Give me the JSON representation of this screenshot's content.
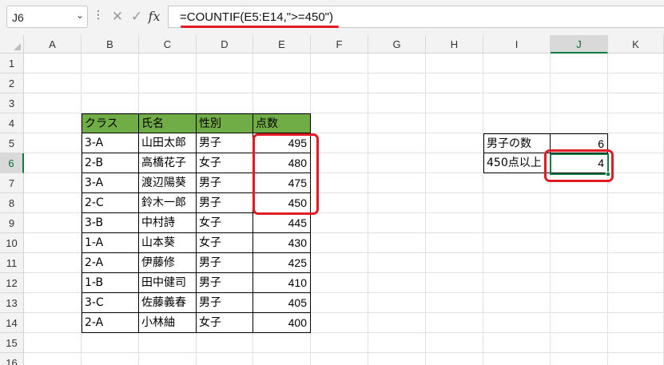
{
  "formula_bar": {
    "name_box": "J6",
    "cancel_icon": "✕",
    "enter_icon": "✓",
    "fx_label": "fx",
    "formula": "=COUNTIF(E5:E14,\">=450\")"
  },
  "columns": [
    "A",
    "B",
    "C",
    "D",
    "E",
    "F",
    "G",
    "H",
    "I",
    "J",
    "K"
  ],
  "rows": [
    "1",
    "2",
    "3",
    "4",
    "5",
    "6",
    "7",
    "8",
    "9",
    "10",
    "11",
    "12",
    "13",
    "14",
    "15",
    "16"
  ],
  "table": {
    "headers": [
      "クラス",
      "氏名",
      "性別",
      "点数"
    ],
    "rows": [
      [
        "3-A",
        "山田太郎",
        "男子",
        "495"
      ],
      [
        "2-B",
        "高橋花子",
        "女子",
        "480"
      ],
      [
        "3-A",
        "渡辺陽葵",
        "男子",
        "475"
      ],
      [
        "2-C",
        "鈴木一郎",
        "男子",
        "450"
      ],
      [
        "3-B",
        "中村詩",
        "女子",
        "445"
      ],
      [
        "1-A",
        "山本葵",
        "女子",
        "430"
      ],
      [
        "2-A",
        "伊藤修",
        "男子",
        "425"
      ],
      [
        "1-B",
        "田中健司",
        "男子",
        "410"
      ],
      [
        "3-C",
        "佐藤義春",
        "男子",
        "405"
      ],
      [
        "2-A",
        "小林紬",
        "女子",
        "400"
      ]
    ]
  },
  "summary": [
    {
      "label": "男子の数",
      "value": "6"
    },
    {
      "label": "450点以上",
      "value": "4"
    }
  ],
  "colors": {
    "header_fill": "#70ad47",
    "selection": "#107c41",
    "highlight": "#e01b24"
  }
}
